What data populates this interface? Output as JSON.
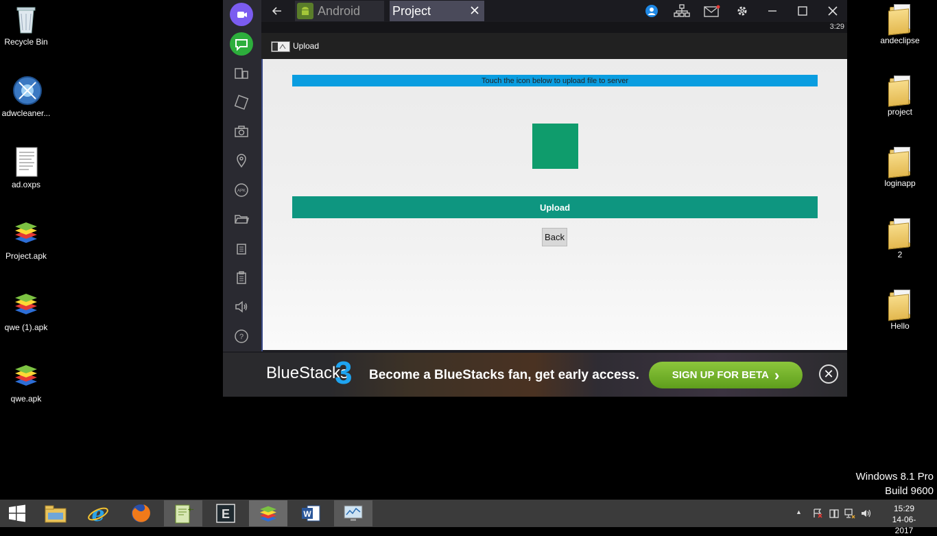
{
  "desktop": {
    "left_icons": [
      {
        "label": "Recycle Bin",
        "icon": "recycle-bin-icon"
      },
      {
        "label": "adwcleaner...",
        "icon": "adwcleaner-icon"
      },
      {
        "label": "ad.oxps",
        "icon": "document-icon"
      },
      {
        "label": "Project.apk",
        "icon": "bluestacks-apk-icon"
      },
      {
        "label": "qwe (1).apk",
        "icon": "bluestacks-apk-icon"
      },
      {
        "label": "qwe.apk",
        "icon": "bluestacks-apk-icon"
      }
    ],
    "right_icons": [
      {
        "label": "andeclipse",
        "icon": "folder-icon"
      },
      {
        "label": "project",
        "icon": "folder-icon"
      },
      {
        "label": "loginapp",
        "icon": "folder-icon"
      },
      {
        "label": "2",
        "icon": "folder-icon"
      },
      {
        "label": "Hello",
        "icon": "folder-icon"
      }
    ],
    "watermark": {
      "line1": "Windows 8.1 Pro",
      "line2": "Build 9600"
    }
  },
  "bluestacks": {
    "tabs": [
      {
        "label": "Android",
        "icon": "android-icon"
      },
      {
        "label": "Project",
        "active": true
      }
    ],
    "status_time": "3:29",
    "app": {
      "title": "Upload",
      "info_text": "Touch the icon below to upload file to server",
      "upload_label": "Upload",
      "back_label": "Back"
    },
    "banner": {
      "brand": "BlueStacks",
      "brand_number": "3",
      "tagline": "Become a BlueStacks fan, get early access.",
      "cta": "SIGN UP FOR BETA",
      "cta_arrow": "›",
      "close_symbol": "✕"
    }
  },
  "taskbar": {
    "clock_time": "15:29",
    "clock_date": "14-06-2017",
    "tray_chevron": "▲"
  },
  "colors": {
    "info_bar": "#0a9de0",
    "upload_button": "#0e9680",
    "upload_target": "#0f9c6c",
    "beta_button": "#7ab82e"
  }
}
